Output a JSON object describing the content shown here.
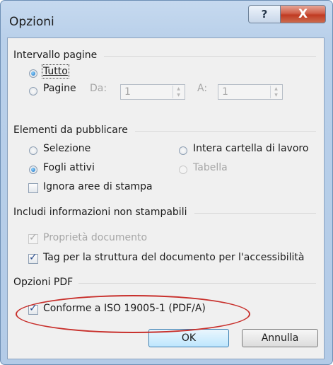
{
  "window": {
    "title": "Opzioni",
    "help_glyph": "?",
    "close_glyph": "X"
  },
  "range": {
    "group_label": "Intervallo pagine",
    "all_label": "Tutto",
    "pages_label": "Pagine",
    "from_label": "Da:",
    "from_value": "1",
    "to_label": "A:",
    "to_value": "1"
  },
  "publish": {
    "group_label": "Elementi da pubblicare",
    "selection_label": "Selezione",
    "workbook_label": "Intera cartella di lavoro",
    "active_sheets_label": "Fogli attivi",
    "table_label": "Tabella",
    "ignore_print_areas_label": "Ignora aree di stampa"
  },
  "nonprint": {
    "group_label": "Includi informazioni non stampabili",
    "doc_props_label": "Proprietà documento",
    "struct_tags_label": "Tag per la struttura del documento per l'accessibilità"
  },
  "pdf": {
    "group_label": "Opzioni PDF",
    "iso_label": "Conforme a ISO 19005-1 (PDF/A)"
  },
  "buttons": {
    "ok": "OK",
    "cancel": "Annulla"
  },
  "icons": {
    "spin_up": "▲",
    "spin_down": "▼"
  },
  "colors": {
    "annotation_ellipse": "#c8302c",
    "close_button": "#c03b22",
    "frame": "#b9d0ea"
  }
}
